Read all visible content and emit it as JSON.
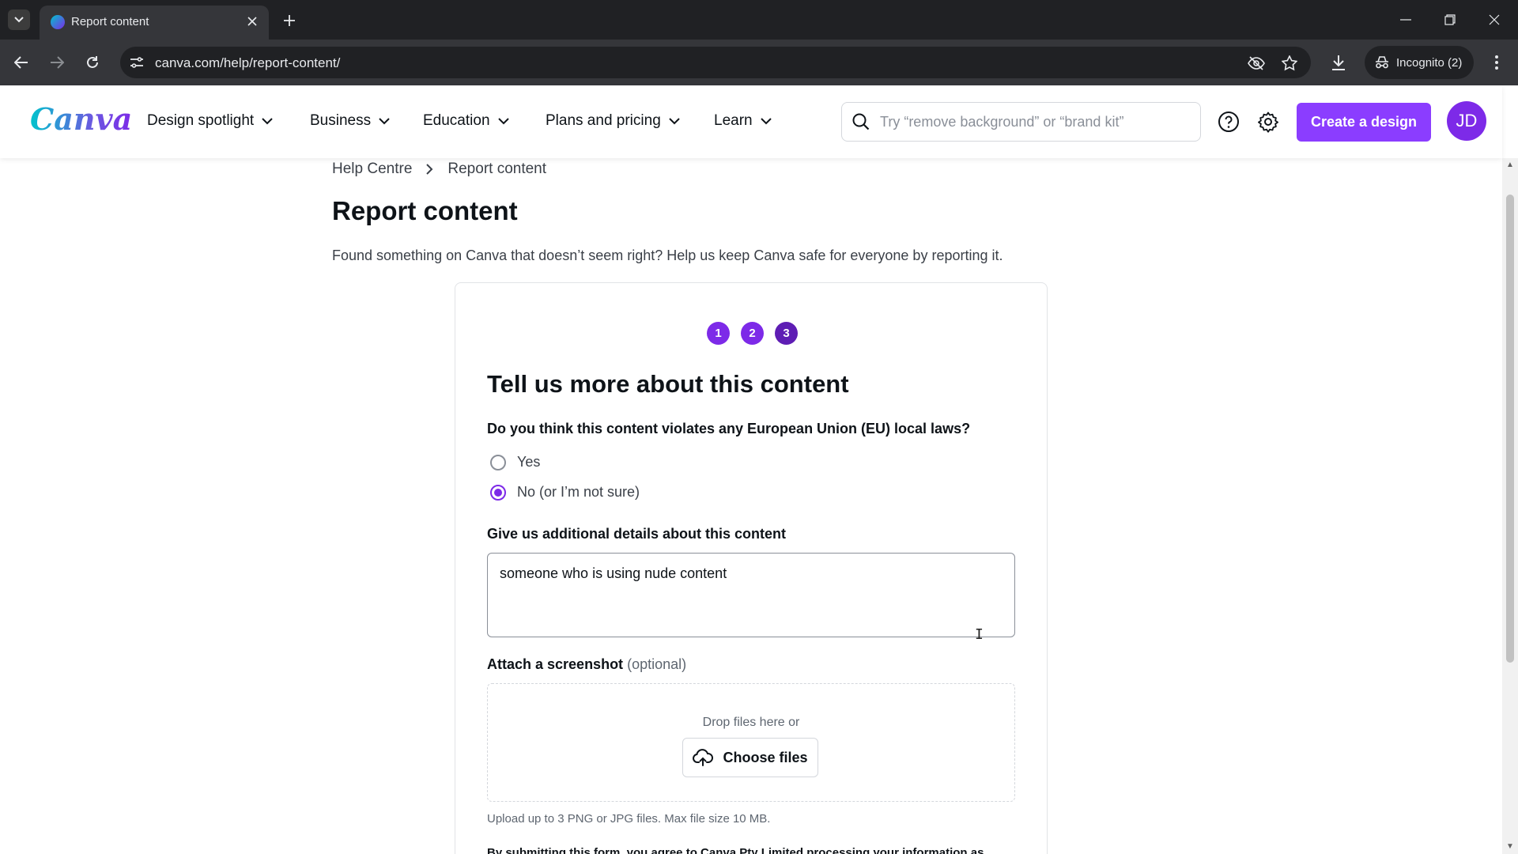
{
  "browser": {
    "tab_title": "Report content",
    "url": "canva.com/help/report-content/",
    "incognito_label": "Incognito (2)"
  },
  "header": {
    "logo": "Canva",
    "nav": [
      {
        "label": "Design spotlight"
      },
      {
        "label": "Business"
      },
      {
        "label": "Education"
      },
      {
        "label": "Plans and pricing"
      },
      {
        "label": "Learn"
      }
    ],
    "search_placeholder": "Try “remove background” or “brand kit”",
    "create_label": "Create a design",
    "avatar_initials": "JD"
  },
  "breadcrumb": {
    "home": "Help Centre",
    "current": "Report content"
  },
  "page": {
    "title": "Report content",
    "intro": "Found something on Canva that doesn’t seem right? Help us keep Canva safe for everyone by reporting it."
  },
  "form": {
    "steps": [
      "1",
      "2",
      "3"
    ],
    "current_step": 3,
    "title": "Tell us more about this content",
    "question": "Do you think this content violates any European Union (EU) local laws?",
    "options": [
      {
        "label": "Yes",
        "checked": false
      },
      {
        "label": "No (or I’m not sure)",
        "checked": true
      }
    ],
    "details_label": "Give us additional details about this content",
    "details_value": "someone who is using nude content",
    "attach_label": "Attach a screenshot",
    "attach_optional": "(optional)",
    "drop_text": "Drop files here or",
    "choose_label": "Choose files",
    "upload_hint": "Upload up to 3 PNG or JPG files. Max file size 10 MB.",
    "consent_text": "By submitting this form, you agree to Canva Pty Limited processing your information as"
  },
  "colors": {
    "brand": "#7d2ae8",
    "create_button": "#8b3dff"
  }
}
